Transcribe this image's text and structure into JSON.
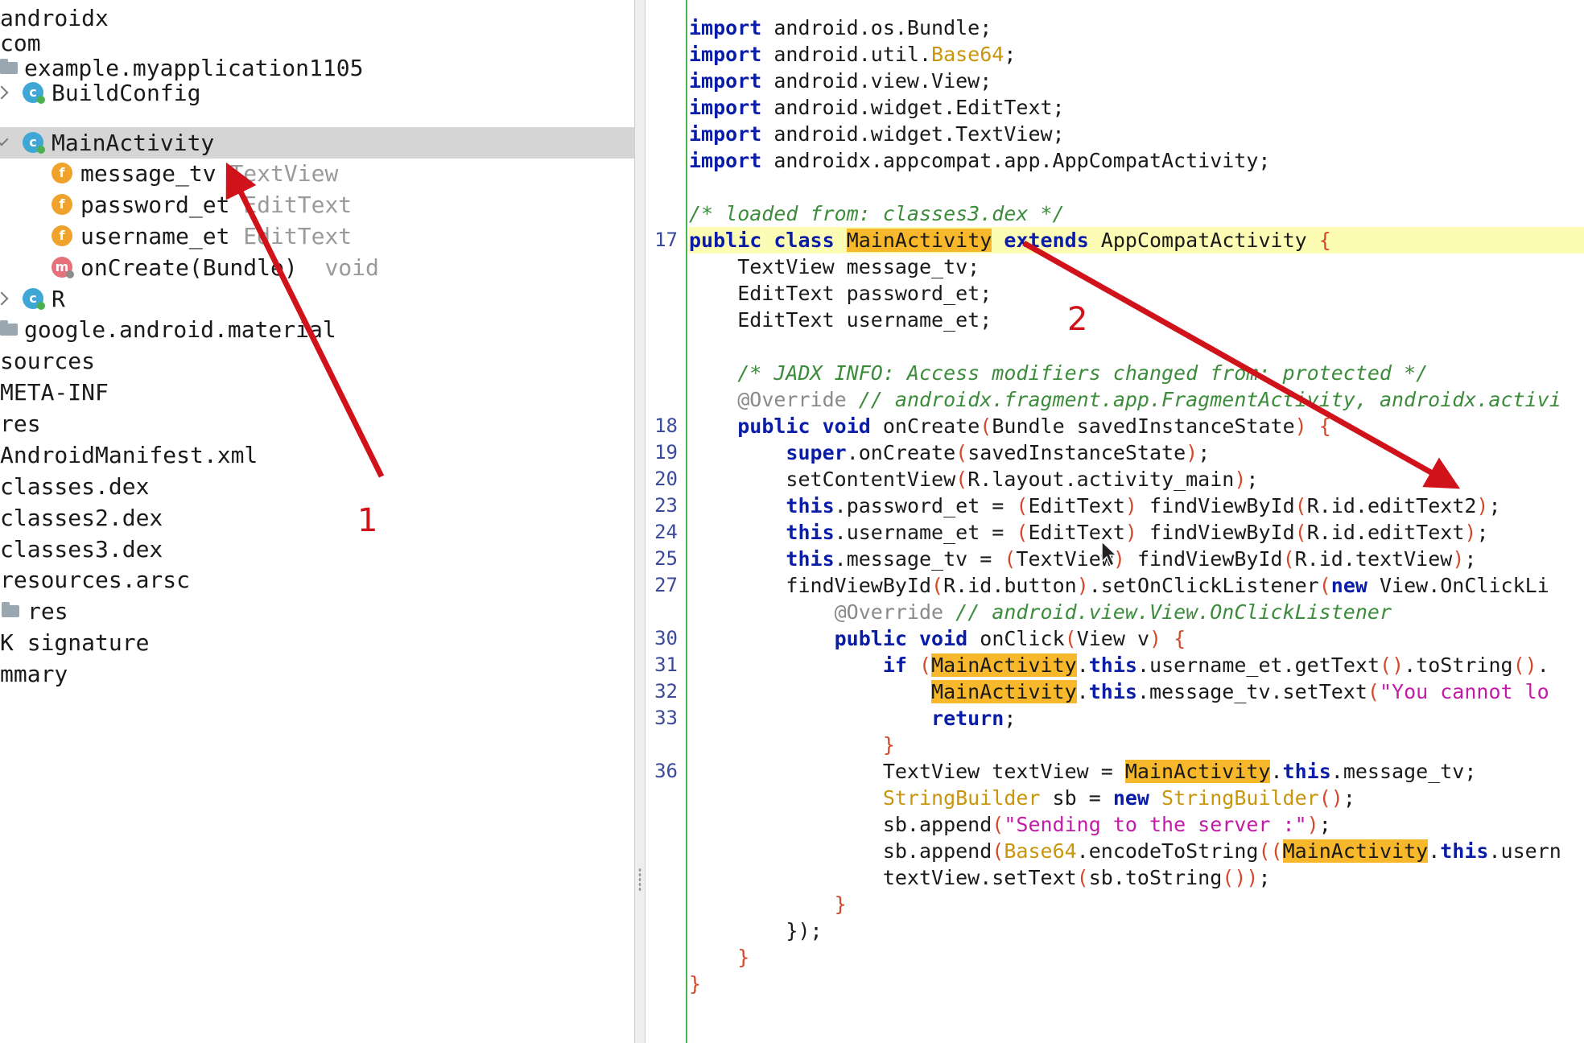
{
  "tree": {
    "items": [
      {
        "label": "androidx"
      },
      {
        "label": "com"
      },
      {
        "label": "example.myapplication1105"
      },
      {
        "label": "BuildConfig"
      },
      {
        "label": "MainActivity"
      },
      {
        "label": "message_tv",
        "type": "TextView"
      },
      {
        "label": "password_et",
        "type": "EditText"
      },
      {
        "label": "username_et",
        "type": "EditText"
      },
      {
        "label": "onCreate(Bundle)",
        "type": "void"
      },
      {
        "label": "R"
      },
      {
        "label": "google.android.material"
      },
      {
        "label": "sources"
      },
      {
        "label": "META-INF"
      },
      {
        "label": "res"
      },
      {
        "label": "AndroidManifest.xml"
      },
      {
        "label": "classes.dex"
      },
      {
        "label": "classes2.dex"
      },
      {
        "label": "classes3.dex"
      },
      {
        "label": "resources.arsc"
      },
      {
        "label": "res"
      },
      {
        "label": "K signature"
      },
      {
        "label": "mmary"
      }
    ],
    "icons": {
      "class": "c",
      "field": "f",
      "method": "m"
    }
  },
  "gutter": {
    "numbers": [
      "17",
      "18",
      "19",
      "20",
      "23",
      "24",
      "25",
      "27",
      "30",
      "31",
      "32",
      "33",
      "36"
    ]
  },
  "code": {
    "kw_import": "import",
    "l1": " android.os.Bundle;",
    "l2a": " android.util.",
    "l2b": "Base64",
    "l2c": ";",
    "l3": " android.view.View;",
    "l4": " android.widget.EditText;",
    "l5": " android.widget.TextView;",
    "l6": " androidx.appcompat.app.AppCompatActivity;",
    "l8": "/* loaded from: classes3.dex */",
    "kw_public": "public",
    "kw_class": "class",
    "kw_extends": "extends",
    "cls_main": "MainActivity",
    "l9_super": " AppCompatActivity ",
    "brace_open": "{",
    "l10": "    TextView message_tv;",
    "l11": "    EditText password_et;",
    "l12": "    EditText username_et;",
    "l14": "    /* JADX INFO: Access modifiers changed from: protected */",
    "override": "@Override",
    "l15c": " // androidx.fragment.app.FragmentActivity, androidx.activi",
    "kw_void": "void",
    "l16a": " onCreate",
    "l16b": "(",
    "l16c": "Bundle savedInstanceState",
    "l16d": ")",
    "l16e": " {",
    "kw_super": "super",
    "l17a": ".onCreate",
    "l17b": "savedInstanceState",
    "l17c": ";",
    "l18a": "setContentView",
    "l18b": "R.layout.activity_main",
    "kw_this": "this",
    "l19a": ".password_et = ",
    "l19b": "EditText",
    "l19c": " findViewById",
    "l19d": "R.id.editText2",
    "l20a": ".username_et = ",
    "l20d": "R.id.editText",
    "l21a": ".message_tv = ",
    "l21b": "TextView",
    "l21d": "R.id.textView",
    "l22a": "findViewById",
    "l22b": "R.id.button",
    "l22c": ".setOnClickListener",
    "kw_new": "new",
    "l22d": " View.OnClickLi",
    "l23c": " // android.view.View.OnClickListener",
    "l24a": " onClick",
    "l24b": "View v",
    "kw_if": "if",
    "l25a": ".username_et.getText",
    "l25b": ".toString",
    "l25c": ".",
    "l26a": ".message_tv.setText",
    "l26s": "\"You cannot lo",
    "kw_return": "return",
    "brace_close": "}",
    "l29a": "TextView textView = ",
    "l29b": ".message_tv;",
    "l30a": "StringBuilder",
    "l30b": " sb = ",
    "l31a": "sb.append",
    "l31s": "\"Sending to the server :\"",
    "l32a": "sb.append",
    "l32b": "Base64",
    "l32c": ".encodeToString",
    "l32d": ".usern",
    "l33a": "textView.setText",
    "l33b": "sb.toString",
    "l35": "});"
  },
  "annotations": {
    "label1": "1",
    "label2": "2"
  },
  "colors": {
    "arrow": "#d0121b",
    "highlight": "#f7b92b",
    "selected_row": "#d5d5d5"
  }
}
